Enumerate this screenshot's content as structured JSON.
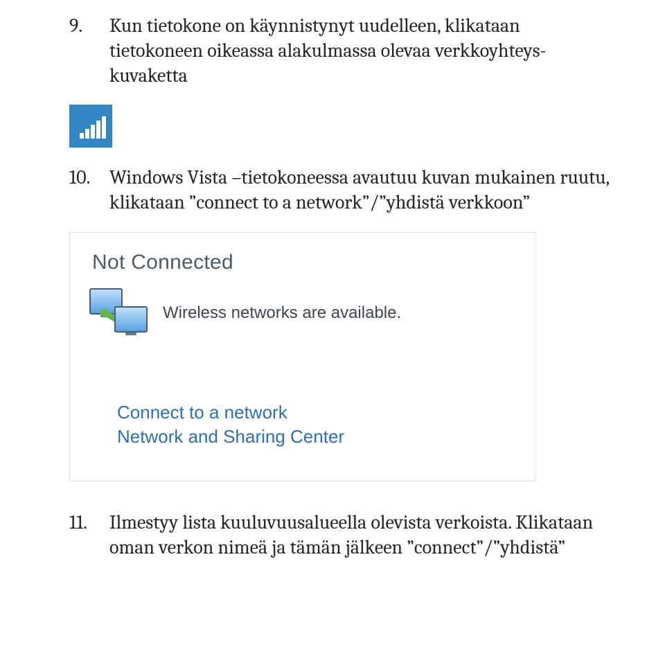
{
  "item9": {
    "num": "9.",
    "text": "Kun tietokone on käynnistynyt uudelleen, klikataan tietokoneen oikeassa alakulmassa olevaa verkkoyhteys-kuvaketta"
  },
  "item10": {
    "num": "10.",
    "text": "Windows Vista –tietokoneessa avautuu kuvan mukainen ruutu, klikataan ”connect to a network”/”yhdistä verkkoon”"
  },
  "popup": {
    "status": "Not Connected",
    "available": "Wireless networks are available.",
    "link1": "Connect to a network",
    "link2": "Network and Sharing Center"
  },
  "item11": {
    "num": "11.",
    "text": "Ilmestyy lista kuuluvuusalueella olevista verkoista. Klikataan oman verkon nimeä ja tämän jälkeen ”connect”/”yhdistä”"
  }
}
